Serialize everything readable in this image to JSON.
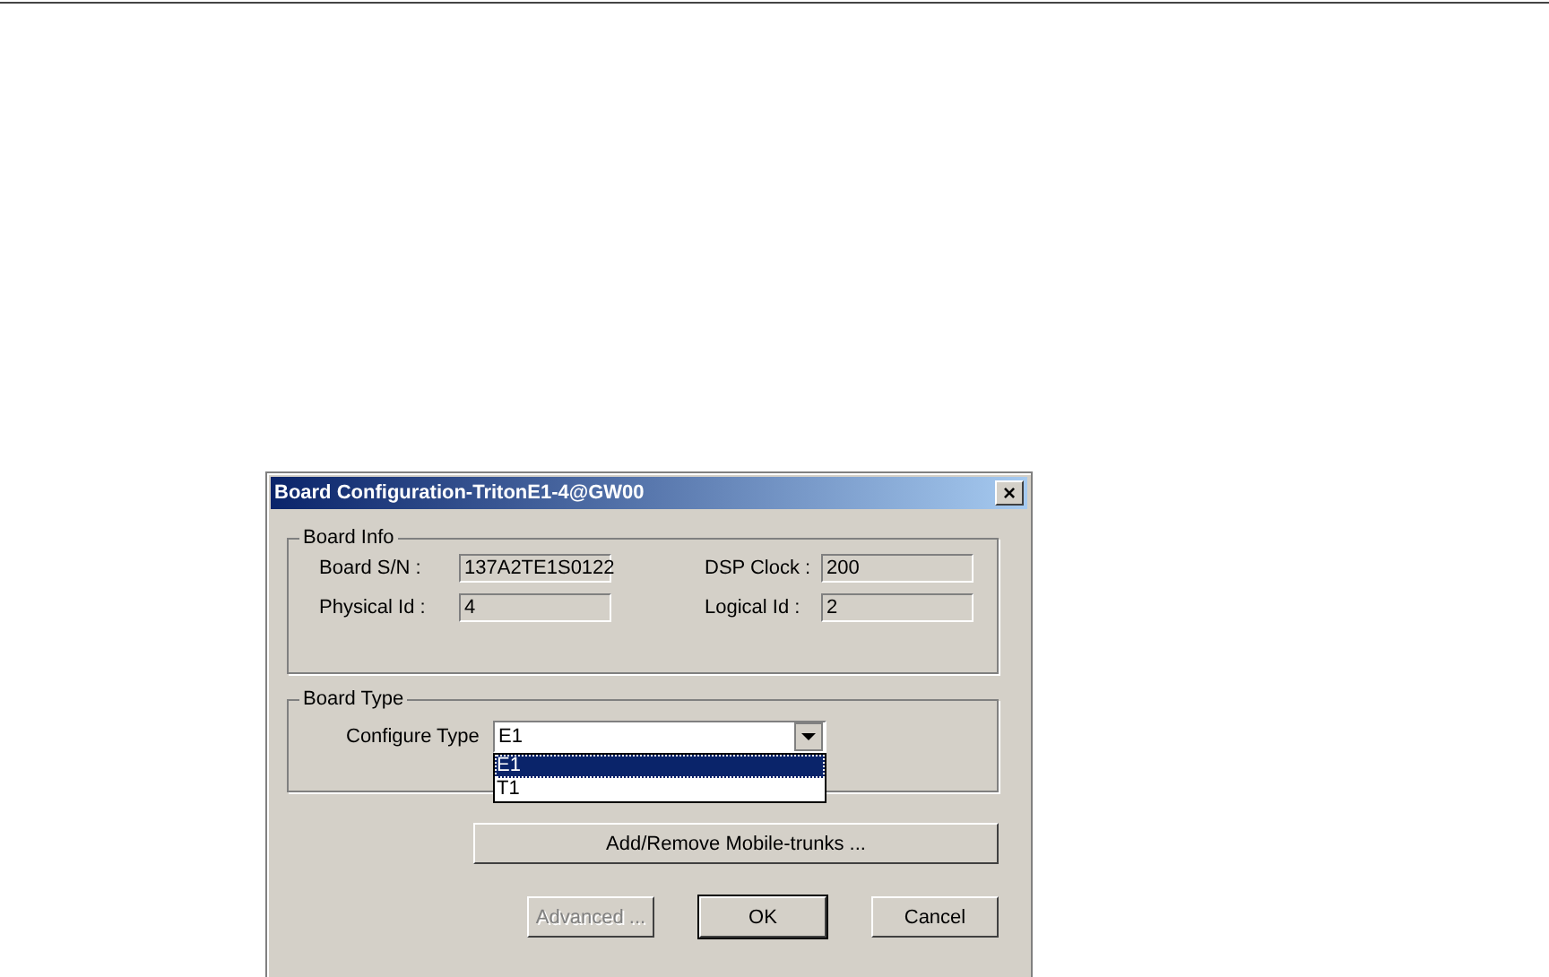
{
  "window": {
    "title": "Board Configuration-TritonE1-4@GW00",
    "close": "×"
  },
  "board_info": {
    "legend": "Board Info",
    "fields": [
      {
        "label": "Board S/N :",
        "value": "137A2TE1S0122"
      },
      {
        "label": "DSP Clock :",
        "value": "200"
      },
      {
        "label": "Physical Id :",
        "value": "4"
      },
      {
        "label": "Logical Id :",
        "value": "2"
      }
    ]
  },
  "board_type": {
    "legend": "Board Type",
    "configure_type": {
      "label": "Configure Type",
      "value": "E1",
      "expanded": true,
      "options": [
        {
          "label": "E1",
          "selected": true
        },
        {
          "label": "T1",
          "selected": false
        }
      ]
    }
  },
  "mobile_trunks_button": {
    "label": "Add/Remove Mobile-trunks ...",
    "disabled": false
  },
  "buttons": [
    {
      "label": "Advanced ...",
      "disabled": true,
      "default": false
    },
    {
      "label": "OK",
      "disabled": false,
      "default": true
    },
    {
      "label": "Cancel",
      "disabled": false,
      "default": false
    }
  ]
}
